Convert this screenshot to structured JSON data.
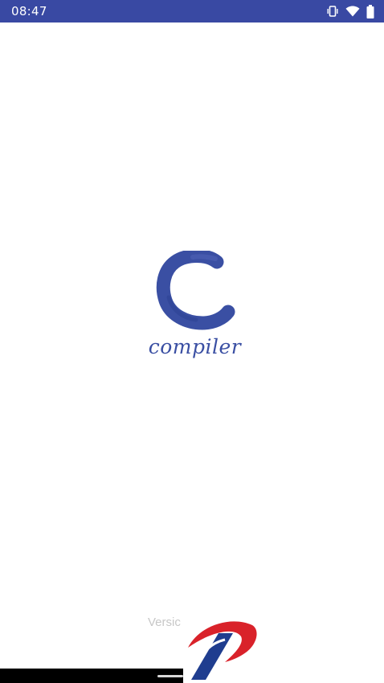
{
  "status_bar": {
    "time": "08:47",
    "background": "#3949a3",
    "icons": [
      "vibrate-icon",
      "wifi-icon",
      "battery-icon"
    ]
  },
  "splash": {
    "logo_letter": "C",
    "logo_word": "compiler",
    "brand_color": "#3a4fa3"
  },
  "footer": {
    "version_text": "Versic"
  },
  "overlay": {
    "icon": "brand-badge-icon"
  }
}
